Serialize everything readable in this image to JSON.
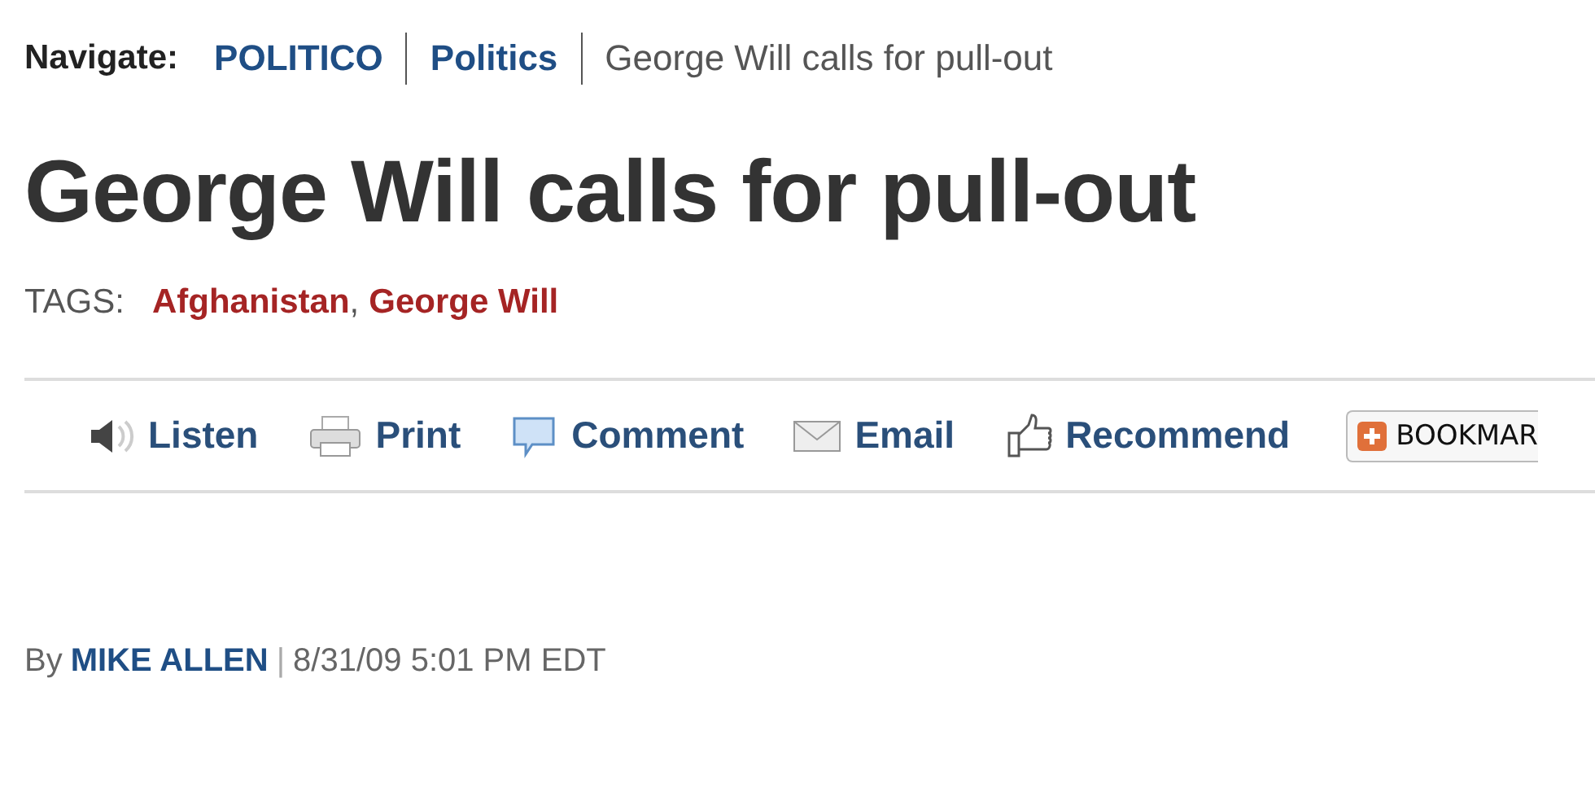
{
  "breadcrumb": {
    "label": "Navigate:",
    "links": [
      "POLITICO",
      "Politics"
    ],
    "current": "George Will calls for pull-out"
  },
  "headline": "George Will calls for pull-out",
  "tags": {
    "label": "TAGS:",
    "items": [
      "Afghanistan",
      "George Will"
    ],
    "separator": ","
  },
  "actions": [
    {
      "kind": "listen",
      "label": "Listen"
    },
    {
      "kind": "print",
      "label": "Print"
    },
    {
      "kind": "comment",
      "label": "Comment"
    },
    {
      "kind": "email",
      "label": "Email"
    },
    {
      "kind": "recommend",
      "label": "Recommend"
    }
  ],
  "bookmark": {
    "label": "BOOKMAR"
  },
  "byline": {
    "prefix": "By",
    "author": "MIKE ALLEN",
    "separator": "|",
    "date": "8/31/09 5:01 PM EDT"
  }
}
